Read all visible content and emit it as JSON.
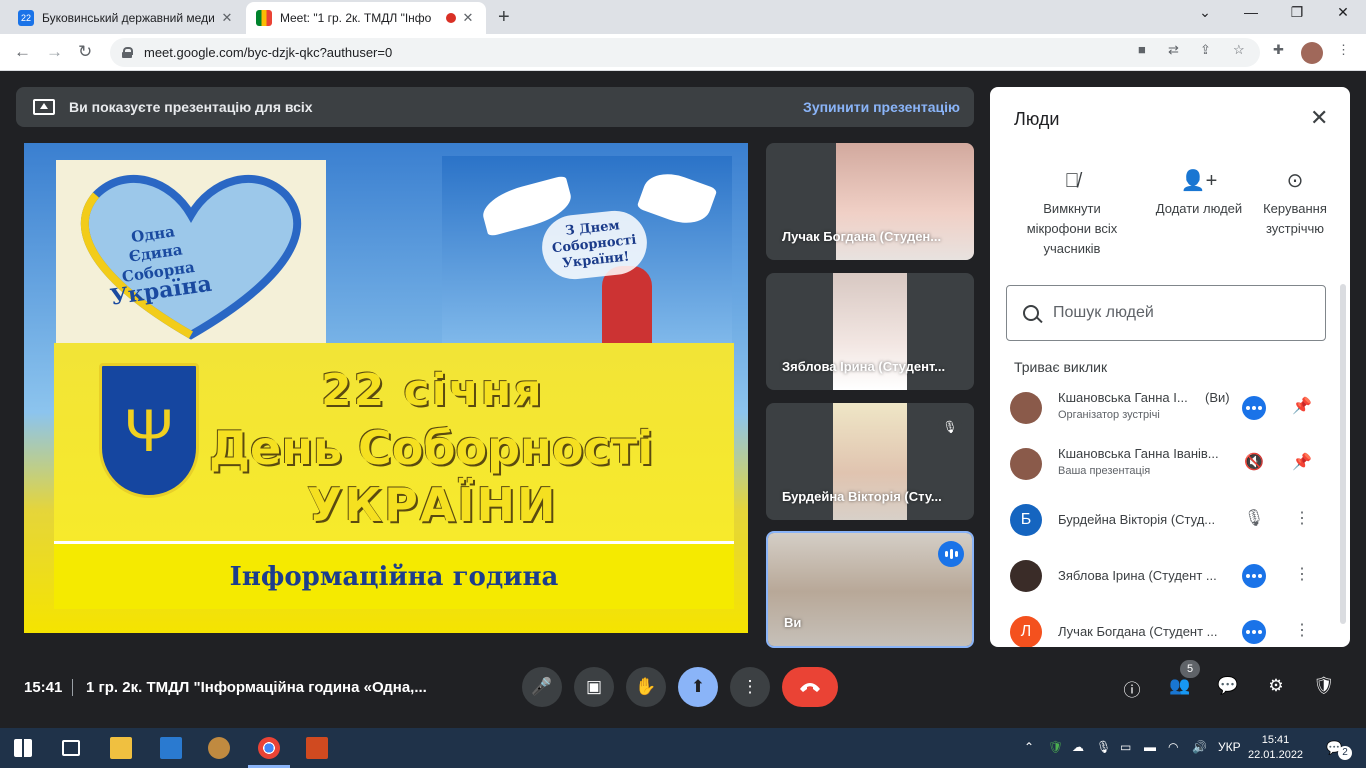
{
  "browser": {
    "tabs": [
      {
        "title": "Буковинський державний меди",
        "favicon": "22"
      },
      {
        "title": "Meet: \"1 гр. 2к. ТМДЛ \"Інфо"
      }
    ],
    "url": "meet.google.com/byc-dzjk-qkc?authuser=0"
  },
  "banner": {
    "text": "Ви показуєте презентацію для всіх",
    "stop_label": "Зупинити презентацію"
  },
  "slide": {
    "heart_line1": "Одна",
    "heart_line2": "Єдина",
    "heart_line3": "Соборна",
    "heart_line4": "Україна",
    "dove_line1": "З Днем",
    "dove_line2": "Соборності",
    "dove_line3": "України!",
    "line1": "22 січня",
    "line2": "День Соборності",
    "line3": "УКРАЇНИ",
    "subtitle": "Інформаційна година"
  },
  "tiles": [
    {
      "name": "Лучак Богдана (Студен..."
    },
    {
      "name": "Зяблова Ірина (Студент..."
    },
    {
      "name": "Бурдейна Вікторія (Сту..."
    },
    {
      "name": "Ви"
    }
  ],
  "panel": {
    "title": "Люди",
    "actions": [
      {
        "label": "Вимкнути мікрофони всіх учасників",
        "icon": "mic-off-icon"
      },
      {
        "label": "Додати людей",
        "icon": "add-person-icon"
      },
      {
        "label": "Керування зустріччю",
        "icon": "toggle-icon"
      }
    ],
    "search_placeholder": "Пошук людей",
    "section": "Триває виклик",
    "people": [
      {
        "name": "Кшановська Ганна І...",
        "you": "(Ви)",
        "sub": "Організатор зустрічі",
        "initial": "",
        "color": "#8a5a4a"
      },
      {
        "name": "Кшановська Ганна Іванів...",
        "sub": "Ваша презентація",
        "initial": "",
        "color": "#8a5a4a"
      },
      {
        "name": "Бурдейна Вікторія (Студ...",
        "initial": "Б",
        "color": "#1565c0"
      },
      {
        "name": "Зяблова Ірина (Студент ...",
        "initial": "",
        "color": "#3a2c28"
      },
      {
        "name": "Лучак Богдана (Студент ...",
        "initial": "Л",
        "color": "#f4511e"
      }
    ]
  },
  "controls": {
    "time": "15:41",
    "meeting_name": "1 гр. 2к. ТМДЛ \"Інформаційна година «Одна,...",
    "people_count": "5"
  },
  "taskbar": {
    "lang": "УКР",
    "time": "15:41",
    "date": "22.01.2022",
    "notifications": "2"
  }
}
